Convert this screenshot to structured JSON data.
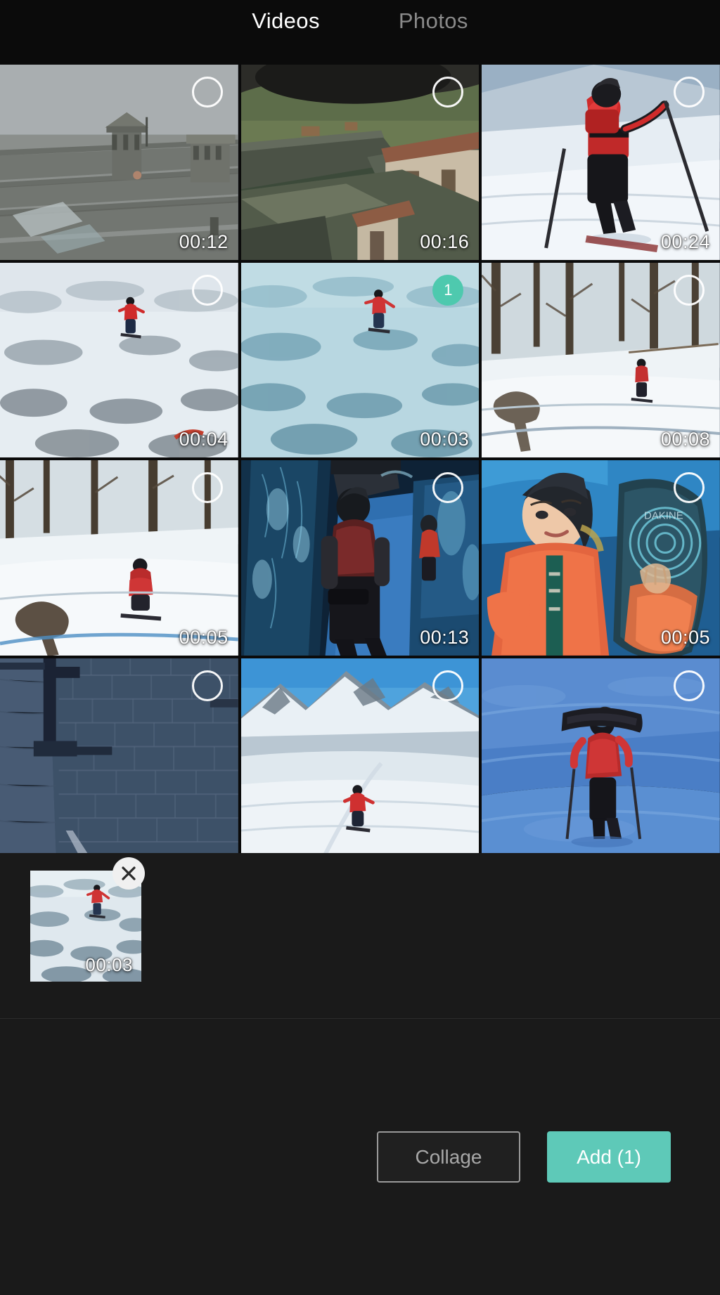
{
  "app": {
    "background_color": "#111111",
    "accent_color": "#5ec9b8",
    "selected_badge_color": "#4ec9ae"
  },
  "tabs": [
    {
      "id": "videos",
      "label": "Videos",
      "active": true
    },
    {
      "id": "photos",
      "label": "Photos",
      "active": false
    }
  ],
  "grid": {
    "columns": 3,
    "rows": 4,
    "items": [
      {
        "index": 0,
        "duration": "00:12",
        "selected": false,
        "selection_number": "",
        "scene": "stone-roof-tiles-chimneys"
      },
      {
        "index": 1,
        "duration": "00:16",
        "selected": false,
        "selection_number": "",
        "scene": "village-rooftops-valley"
      },
      {
        "index": 2,
        "duration": "00:24",
        "selected": false,
        "selection_number": "",
        "scene": "skier-red-jacket-slope"
      },
      {
        "index": 3,
        "duration": "00:04",
        "selected": false,
        "selection_number": "",
        "scene": "snowfield-rider-distant"
      },
      {
        "index": 4,
        "duration": "00:03",
        "selected": true,
        "selection_number": "1",
        "scene": "snowfield-rider-blue-tint"
      },
      {
        "index": 5,
        "duration": "00:08",
        "selected": false,
        "selection_number": "",
        "scene": "forest-snow-hiker"
      },
      {
        "index": 6,
        "duration": "00:05",
        "selected": false,
        "selection_number": "",
        "scene": "forest-snow-sitting-rider"
      },
      {
        "index": 7,
        "duration": "00:13",
        "selected": false,
        "selection_number": "",
        "scene": "ice-cave-blue-corridor"
      },
      {
        "index": 8,
        "duration": "00:05",
        "selected": false,
        "selection_number": "",
        "scene": "portrait-woman-snowboard"
      },
      {
        "index": 9,
        "duration": "",
        "selected": false,
        "selection_number": "",
        "scene": "stone-wall-passage"
      },
      {
        "index": 10,
        "duration": "",
        "selected": false,
        "selection_number": "",
        "scene": "glacier-valley-rider"
      },
      {
        "index": 11,
        "duration": "",
        "selected": false,
        "selection_number": "",
        "scene": "blue-slope-rider-carrying-board"
      }
    ]
  },
  "tray": {
    "items": [
      {
        "duration": "00:03",
        "close_label": "×",
        "scene": "snowfield-rider-selected"
      }
    ]
  },
  "actions": {
    "collage_label": "Collage",
    "add_label": "Add (1)"
  }
}
